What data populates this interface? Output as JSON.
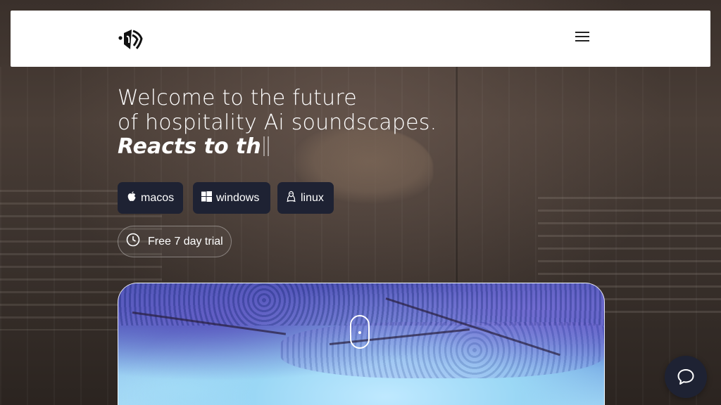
{
  "header": {
    "logo_icon": "sound-wave-logo-icon",
    "menu_icon": "hamburger-menu-icon"
  },
  "hero": {
    "line1": "Welcome to the future",
    "line2": "of hospitality Ai soundscapes.",
    "typed_text": "Reacts to th"
  },
  "os_buttons": [
    {
      "label": "macos",
      "icon": "apple-icon"
    },
    {
      "label": "windows",
      "icon": "windows-icon"
    },
    {
      "label": "linux",
      "icon": "linux-tux-icon"
    }
  ],
  "trial": {
    "label": "Free 7 day trial",
    "icon": "clock-icon"
  },
  "video": {
    "scroll_icon": "scroll-mouse-icon"
  },
  "chat": {
    "icon": "chat-bubble-icon"
  },
  "colors": {
    "button_bg": "#1e2233",
    "header_bg": "#ffffff",
    "text": "#ffffff"
  }
}
